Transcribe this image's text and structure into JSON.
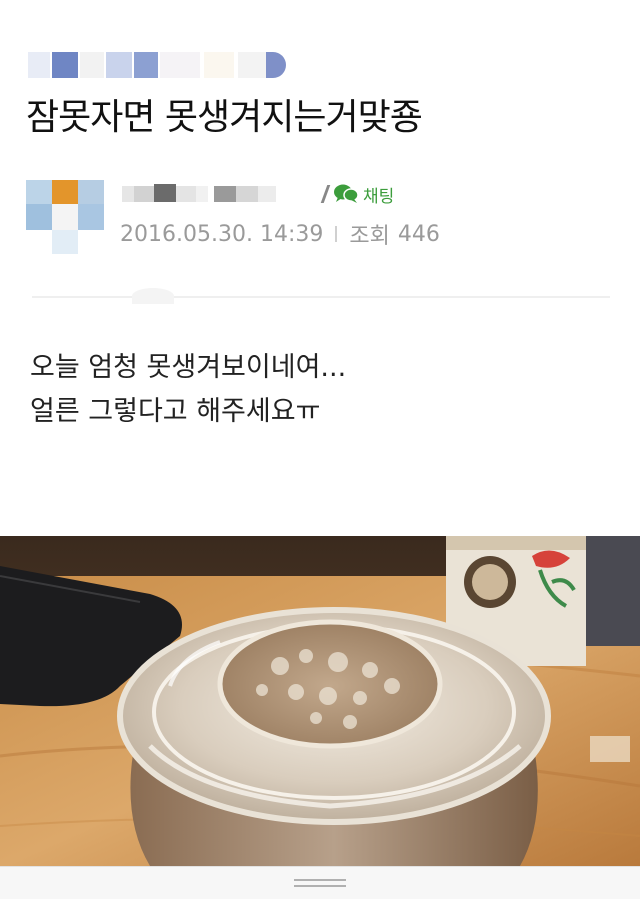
{
  "post": {
    "title": "잠못자면 못생겨지는거맞죵",
    "author": {
      "chat_label": "채팅"
    },
    "date": "2016.05.30. 14:39",
    "views_label": "조회",
    "views": "446",
    "body_lines": [
      "오늘 엄청 못생겨보이네여...",
      "얼른 그렇다고 해주세요ㅠ"
    ]
  },
  "colors": {
    "chat_green": "#3c9d3c",
    "meta_gray": "#9a9a9a",
    "divider": "#efefef"
  },
  "icons": {
    "chat": "speech-bubble-icon"
  }
}
